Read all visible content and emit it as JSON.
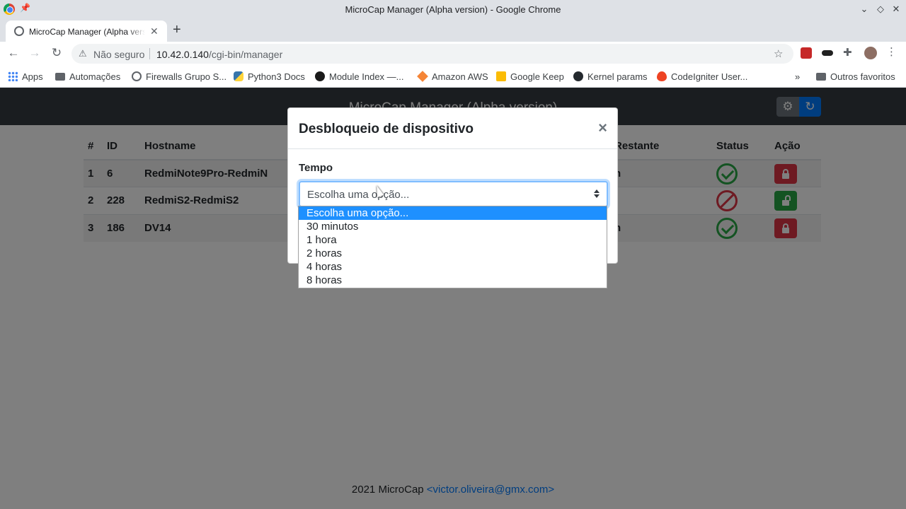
{
  "window": {
    "title": "MicroCap Manager (Alpha version) - Google Chrome"
  },
  "tab": {
    "title": "MicroCap Manager (Alpha version)"
  },
  "omnibox": {
    "security_label": "Não seguro",
    "url_host": "10.42.0.140",
    "url_path": "/cgi-bin/manager"
  },
  "bookmarks": {
    "items": [
      {
        "label": "Apps",
        "icon": "apps-grid-icon"
      },
      {
        "label": "Automações",
        "icon": "folder-icon"
      },
      {
        "label": "Firewalls Grupo S...",
        "icon": "globe-icon"
      },
      {
        "label": "Python3 Docs",
        "icon": "python-icon"
      },
      {
        "label": "Module Index —...",
        "icon": "ansible-icon"
      },
      {
        "label": "Amazon AWS",
        "icon": "aws-cube-icon"
      },
      {
        "label": "Google Keep",
        "icon": "keep-icon"
      },
      {
        "label": "Kernel params",
        "icon": "github-icon"
      },
      {
        "label": "CodeIgniter User...",
        "icon": "codeigniter-flame-icon"
      }
    ],
    "more": "»",
    "other": "Outros favoritos"
  },
  "app": {
    "brand": "MicroCap Manager (Alpha version)",
    "settings_icon": "⚙",
    "refresh_icon": "↻"
  },
  "table": {
    "headers": [
      "#",
      "ID",
      "Hostname",
      "Restante",
      "Status",
      "Ação"
    ],
    "rows": [
      {
        "num": "1",
        "id": "6",
        "hostname": "RedmiNote9Pro-RedmiN",
        "remaining": "n",
        "status": "ok",
        "action": "lock"
      },
      {
        "num": "2",
        "id": "228",
        "hostname": "RedmiS2-RedmiS2",
        "remaining": "",
        "status": "blocked",
        "action": "unlock"
      },
      {
        "num": "3",
        "id": "186",
        "hostname": "DV14",
        "remaining": "n",
        "status": "ok",
        "action": "lock"
      }
    ]
  },
  "modal": {
    "title": "Desbloqueio de dispositivo",
    "close": "×",
    "field_label": "Tempo",
    "select_value": "Escolha uma opção...",
    "options": [
      "Escolha uma opção...",
      "30 minutos",
      "1 hora",
      "2 horas",
      "4 horas",
      "8 horas"
    ],
    "selected_index": 0
  },
  "footer": {
    "text": "2021 MicroCap ",
    "link": "<victor.oliveira@gmx.com>"
  },
  "colors": {
    "navbar": "#343a40",
    "primary": "#007bff",
    "success": "#28a745",
    "danger": "#dc3545",
    "option_highlight": "#1e90ff"
  }
}
